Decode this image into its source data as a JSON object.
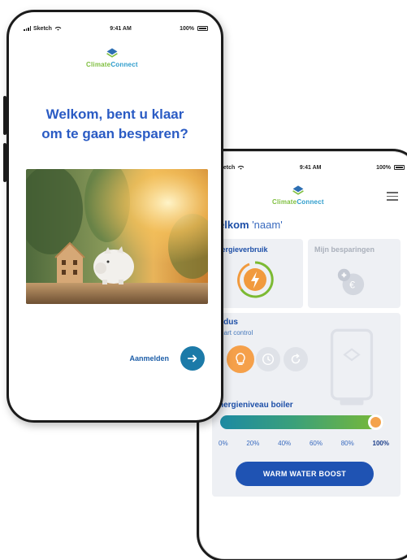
{
  "status_bar": {
    "carrier": "Sketch",
    "time": "9:41 AM",
    "battery": "100%"
  },
  "brand": {
    "part1": "Climate",
    "part2": "Connect",
    "color_green": "#7fbf3f",
    "color_blue": "#2d9ccc"
  },
  "welcome_screen": {
    "title": "Welkom, bent u klaar\nom te gaan besparen?",
    "login_label": "Aanmelden",
    "login_icon": "arrow-right-icon",
    "accent_color": "#1c7aa8"
  },
  "dashboard_screen": {
    "status_carrier": "ketch",
    "greeting_prefix": "elkom",
    "greeting_name": "'naam'",
    "menu_icon": "hamburger-menu-icon",
    "energy_card": {
      "title": "nergieverbruik",
      "icon": "lightning-gauge-icon"
    },
    "savings_card": {
      "title": "Mijn besparingen",
      "icon": "euro-coin-icon"
    },
    "mode_card": {
      "title": "odus",
      "subtitle": "mart control",
      "icons": [
        "lightbulb-icon",
        "clock-icon",
        "refresh-icon"
      ],
      "background_icon": "boiler-icon"
    },
    "boiler_level": {
      "title": "nergieniveau boiler",
      "level_fraction": 1.0,
      "ticks": [
        "0%",
        "20%",
        "40%",
        "60%",
        "80%",
        "100%"
      ],
      "active_tick": "100%"
    },
    "boost_button": "WARM WATER BOOST",
    "primary_color": "#1f53b3"
  }
}
